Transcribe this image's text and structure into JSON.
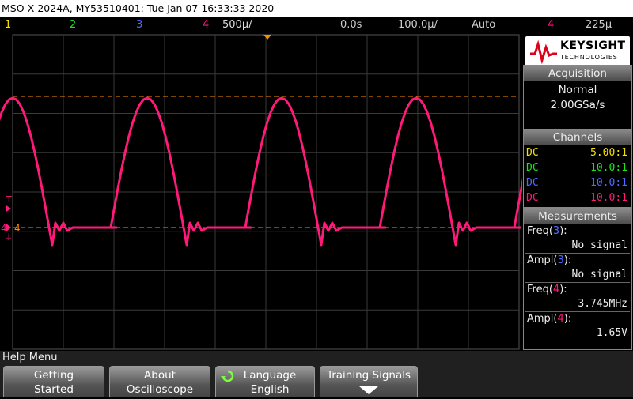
{
  "title": "MSO-X 2024A, MY53510401: Tue Jan 07 16:33:33 2020",
  "status": {
    "ch1": "1",
    "ch2": "2",
    "ch3": "3",
    "ch4": "4",
    "timebase": "500µ/",
    "delay": "0.0s",
    "zoom": "100.0µ/",
    "trigger_mode": "Auto",
    "trigger_source": "4",
    "trigger_level": "225µ"
  },
  "colors": {
    "ch1": "#f5e000",
    "ch2": "#19e619",
    "ch3": "#4d6bff",
    "ch4": "#ff1a7a",
    "trigger_marker": "#ff8c00",
    "grid": "#3a3a3a"
  },
  "screen": {
    "trigger_label": "T",
    "ch4_marker": "4",
    "ground_label": "4"
  },
  "logo": {
    "name": "KEYSIGHT",
    "sub": "TECHNOLOGIES"
  },
  "acquisition": {
    "header": "Acquisition",
    "mode": "Normal",
    "rate": "2.00GSa/s"
  },
  "channels": {
    "header": "Channels",
    "rows": [
      {
        "coupling": "DC",
        "probe": "5.00:1"
      },
      {
        "coupling": "DC",
        "probe": "10.0:1"
      },
      {
        "coupling": "DC",
        "probe": "10.0:1"
      },
      {
        "coupling": "DC",
        "probe": "10.0:1"
      }
    ]
  },
  "measurements": {
    "header": "Measurements",
    "items": [
      {
        "name": "Freq(",
        "ch": "3",
        "close": "):",
        "value": "No signal"
      },
      {
        "name": "Ampl(",
        "ch": "3",
        "close": "):",
        "value": "No signal"
      },
      {
        "name": "Freq(",
        "ch": "4",
        "close": "):",
        "value": "3.745MHz"
      },
      {
        "name": "Ampl(",
        "ch": "4",
        "close": "):",
        "value": "1.65V"
      }
    ]
  },
  "help": {
    "label": "Help Menu",
    "keys": [
      {
        "line1": "Getting",
        "line2": "Started"
      },
      {
        "line1": "About",
        "line2": "Oscilloscope"
      },
      {
        "line1": "Language",
        "line2": "English"
      },
      {
        "line1": "Training Signals",
        "line2": ""
      }
    ]
  }
}
